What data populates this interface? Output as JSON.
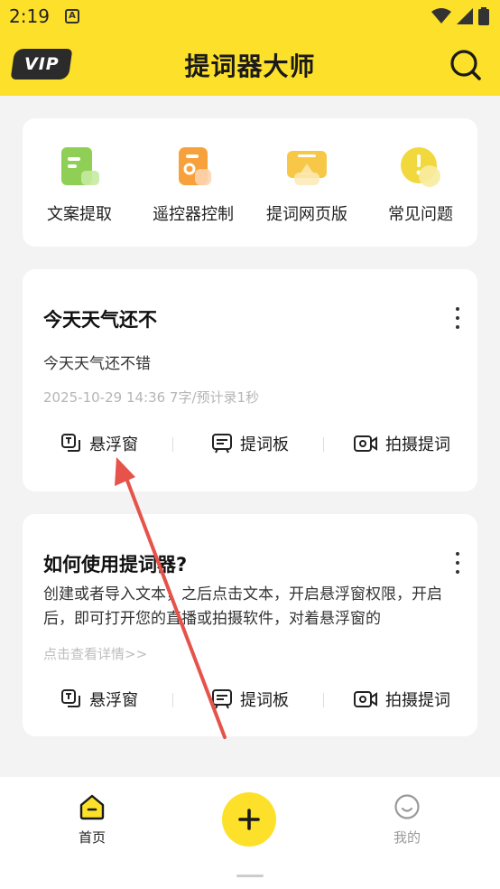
{
  "status_bar": {
    "time": "2:19",
    "notif_icon": "A"
  },
  "header": {
    "vip_label": "VIP",
    "title": "提词器大师"
  },
  "quick_actions": [
    {
      "label": "文案提取",
      "icon": "doc-extract-icon",
      "color": "#8fcf55"
    },
    {
      "label": "遥控器控制",
      "icon": "remote-icon",
      "color": "#f6a13b"
    },
    {
      "label": "提词网页版",
      "icon": "web-icon",
      "color": "#f7c847"
    },
    {
      "label": "常见问题",
      "icon": "faq-icon",
      "color": "#f1d83c"
    }
  ],
  "cards": [
    {
      "title": "今天天气还不",
      "body": "今天天气还不错",
      "meta": "2025-10-29 14:36   7字/预计录1秒",
      "actions": [
        "悬浮窗",
        "提词板",
        "拍摄提词"
      ]
    },
    {
      "title": "如何使用提词器?",
      "body": "创建或者导入文本，之后点击文本，开启悬浮窗权限，开启后，即可打开您的直播或拍摄软件，对着悬浮窗的",
      "meta": "点击查看详情>>",
      "actions": [
        "悬浮窗",
        "提词板",
        "拍摄提词"
      ]
    }
  ],
  "bottom_nav": {
    "home": "首页",
    "mine": "我的"
  },
  "colors": {
    "accent": "#fde02a",
    "annotation_arrow": "#e5534b"
  }
}
